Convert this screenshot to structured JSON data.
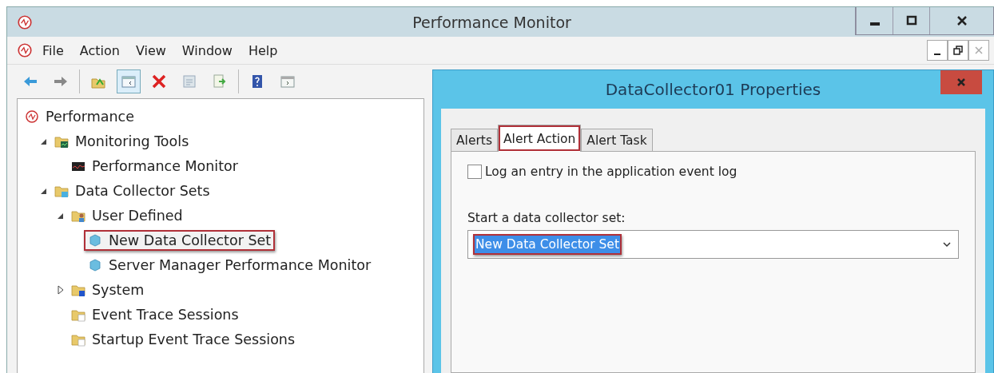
{
  "window": {
    "title": "Performance Monitor"
  },
  "menu": [
    "File",
    "Action",
    "View",
    "Window",
    "Help"
  ],
  "toolbar": [
    {
      "kind": "back",
      "pressed": false
    },
    {
      "kind": "forward",
      "pressed": false
    },
    {
      "kind": "sep"
    },
    {
      "kind": "up",
      "pressed": false
    },
    {
      "kind": "tree",
      "pressed": true
    },
    {
      "kind": "delete",
      "pressed": false
    },
    {
      "kind": "props",
      "pressed": false
    },
    {
      "kind": "export",
      "pressed": false
    },
    {
      "kind": "sep"
    },
    {
      "kind": "help",
      "pressed": false
    },
    {
      "kind": "pane",
      "pressed": false
    }
  ],
  "tree": [
    {
      "label": "Performance",
      "kind": "root",
      "highlighted": false,
      "children": [
        {
          "label": "Monitoring Tools",
          "kind": "tools",
          "expanded": true,
          "highlighted": false,
          "children": [
            {
              "label": "Performance Monitor",
              "kind": "chart",
              "highlighted": false
            }
          ]
        },
        {
          "label": "Data Collector Sets",
          "kind": "sets",
          "expanded": true,
          "highlighted": false,
          "children": [
            {
              "label": "User Defined",
              "kind": "user",
              "expanded": true,
              "highlighted": false,
              "children": [
                {
                  "label": "New Data Collector Set",
                  "kind": "set",
                  "highlighted": true
                },
                {
                  "label": "Server Manager Performance Monitor",
                  "kind": "set",
                  "highlighted": false
                }
              ]
            },
            {
              "label": "System",
              "kind": "system",
              "expanded": false,
              "highlighted": false
            },
            {
              "label": "Event Trace Sessions",
              "kind": "trace",
              "highlighted": false
            },
            {
              "label": "Startup Event Trace Sessions",
              "kind": "trace",
              "highlighted": false
            }
          ]
        }
      ]
    }
  ],
  "dialog": {
    "title": "DataCollector01 Properties",
    "tabs": [
      {
        "label": "Alerts",
        "selected": false,
        "highlighted": false
      },
      {
        "label": "Alert Action",
        "selected": true,
        "highlighted": true
      },
      {
        "label": "Alert Task",
        "selected": false,
        "highlighted": false
      }
    ],
    "log_checkbox": {
      "label": "Log an entry in the application event log",
      "checked": false
    },
    "start_set": {
      "label": "Start a data collector set:",
      "value": "New Data Collector Set",
      "text_selected": true,
      "highlighted": true
    }
  }
}
